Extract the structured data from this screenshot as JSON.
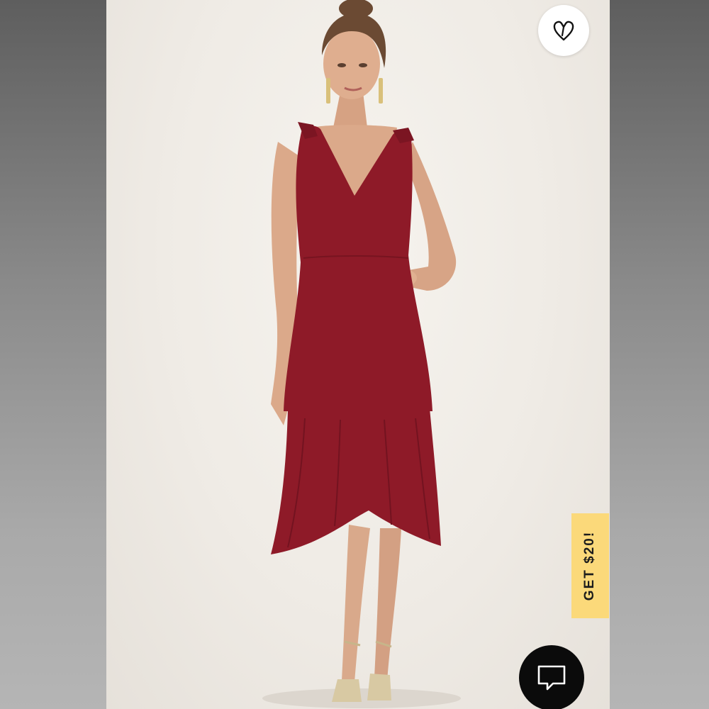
{
  "promo": {
    "label": "GET $20!",
    "background_color": "#fbd97a"
  },
  "favorite": {
    "icon": "heart-outline-icon"
  },
  "chat": {
    "icon": "chat-bubble-icon"
  },
  "product_photo": {
    "dress_color": "#8e1a28",
    "background_color": "#f1ede7"
  }
}
